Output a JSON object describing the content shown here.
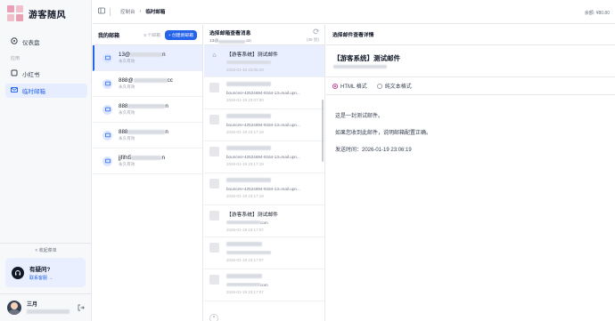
{
  "app": {
    "brand": "游客随风"
  },
  "sidebar": {
    "dashboard_label": "仪表盘",
    "section_label": "应用",
    "items": [
      {
        "label": "小红书"
      },
      {
        "label": "临时邮箱"
      }
    ],
    "collapse_label": "< 收起菜单",
    "help": {
      "title": "有疑问?",
      "link": "联系客服 →"
    },
    "user": {
      "name": "三月"
    }
  },
  "topbar": {
    "breadcrumb_root": "控制台",
    "breadcrumb_current": "临时邮箱",
    "balance": "余额: ¥80.80"
  },
  "mailboxes": {
    "title": "我的邮箱",
    "count": "5 个邮箱",
    "create_label": "+ 创建新邮箱",
    "items": [
      {
        "prefix": "13@",
        "suffix": "n",
        "status": "永久有效"
      },
      {
        "prefix": "888@",
        "suffix": "cc",
        "status": "永久有效"
      },
      {
        "prefix": "888",
        "suffix": "n",
        "status": "永久有效"
      },
      {
        "prefix": "888",
        "suffix": "n",
        "status": "永久有效"
      },
      {
        "prefix": "jjfifn5",
        "suffix": "n",
        "status": "永久有效"
      }
    ]
  },
  "messages": {
    "title": "选择邮箱查看消息",
    "address_prefix": "13@",
    "address_suffix": ".cn",
    "size": "(38 封)",
    "items": [
      {
        "subject": "【游客系统】测试邮件",
        "from": "",
        "time": "2026-01-19 23:06:29"
      },
      {
        "subject": "",
        "from": "bounces+42524694-9164-13=mail.upn...",
        "time": "2026-01-19 23:07:00"
      },
      {
        "subject": "",
        "from": "bounces+42524694-9164-13=mail.upn...",
        "time": "2026-01-19 23:17:19"
      },
      {
        "subject": "",
        "from": "bounces+42524694-9164-13=mail.upn...",
        "time": "2026-01-19 23:17:19"
      },
      {
        "subject": "",
        "from": "bounces+42524694-9164-13=mail.upn...",
        "time": "2026-01-19 23:17:19"
      },
      {
        "subject": "【游客系统】测试邮件",
        "from": "com",
        "time": "2026-01-19 23:17:07"
      },
      {
        "subject": "",
        "from": "",
        "time": "2026-01-19 23:17:07"
      },
      {
        "subject": "",
        "from": "com",
        "time": "2026-01-19 23:17:07"
      }
    ]
  },
  "detail": {
    "header": "选择邮件查看详情",
    "subject": "【游客系统】测试邮件",
    "format_html": "HTML 格式",
    "format_text": "纯文本格式",
    "body_line1": "这是一封测试邮件。",
    "body_line2": "如果您收到此邮件，说明邮箱配置正确。",
    "body_line3": "发送时间：2026-01-19 23:06:19"
  }
}
